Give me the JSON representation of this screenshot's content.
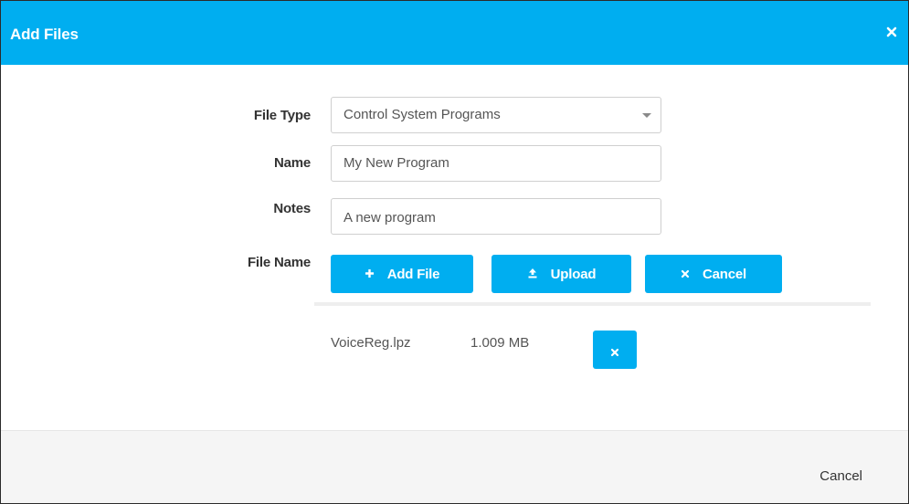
{
  "dialog": {
    "title": "Add Files"
  },
  "form": {
    "file_type": {
      "label": "File Type",
      "selected": "Control System Programs"
    },
    "name": {
      "label": "Name",
      "value": "My New Program"
    },
    "notes": {
      "label": "Notes",
      "value": "A new program"
    },
    "file_name": {
      "label": "File Name"
    }
  },
  "buttons": {
    "add_file": "Add File",
    "upload": "Upload",
    "cancel": "Cancel"
  },
  "files": [
    {
      "name": "VoiceReg.lpz",
      "size": "1.009 MB"
    }
  ],
  "footer": {
    "cancel": "Cancel"
  },
  "colors": {
    "accent": "#00aef0",
    "footer_bg": "#f5f5f5"
  },
  "icons": {
    "close": "close-icon",
    "add": "plus-icon",
    "upload": "upload-icon",
    "cancel": "close-icon",
    "remove": "close-icon",
    "dropdown": "chevron-down-icon"
  }
}
